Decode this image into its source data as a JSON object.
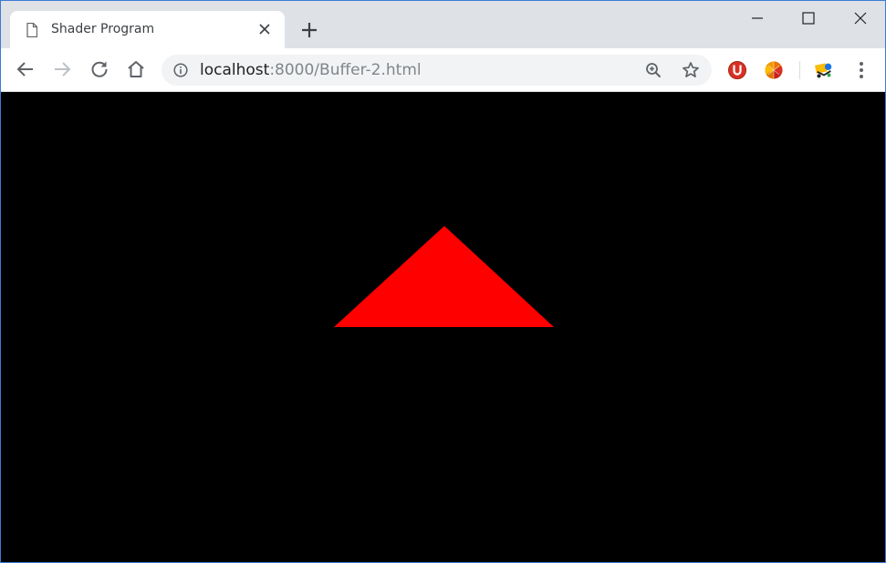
{
  "tab": {
    "title": "Shader Program",
    "icon": "page-icon"
  },
  "toolbar": {
    "url_host": "localhost",
    "url_rest": ":8000/Buffer-2.html"
  },
  "page": {
    "background_color": "#000000",
    "shape_color": "#ff0000",
    "shape": "triangle"
  },
  "colors": {
    "tabstrip": "#dee1e6",
    "omnibox": "#f1f3f4",
    "icon": "#5f6368"
  }
}
